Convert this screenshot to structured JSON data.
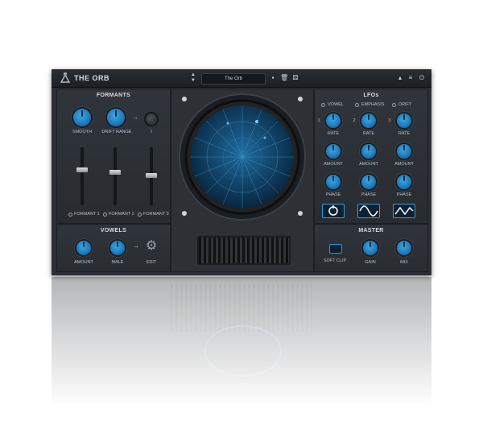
{
  "header": {
    "title": "THE ORB",
    "preset_name": "The Orb"
  },
  "formants": {
    "title": "FORMANTS",
    "smooth_label": "SMOOTH",
    "drift_range_label": "DRIFT RANGE",
    "drift_side_label": "I",
    "channels": [
      {
        "label": "FORMANT 1"
      },
      {
        "label": "FORMANT 2"
      },
      {
        "label": "FORMANT 3"
      }
    ]
  },
  "vowels": {
    "title": "VOWELS",
    "amount_label": "AMOUNT",
    "male_label": "MALE",
    "edit_label": "EDIT"
  },
  "lfos": {
    "title": "LFOs",
    "targets": [
      "VOWEL",
      "EMPHASIS",
      "DRIFT"
    ],
    "rate_labels": [
      "RATE",
      "RATE",
      "RATE"
    ],
    "amount_labels": [
      "AMOUNT",
      "AMOUNT",
      "AMOUNT"
    ],
    "phase_labels": [
      "PHASE",
      "PHASE",
      "PHASE"
    ],
    "number_labels": [
      "1",
      "2",
      "3"
    ],
    "shapes": [
      "cycle",
      "sine",
      "triangle"
    ]
  },
  "master": {
    "title": "MASTER",
    "soft_clip_label": "SOFT CLIP",
    "gain_label": "GAIN",
    "mix_label": "MIX"
  },
  "colors": {
    "accent": "#2f93d6",
    "panel": "#2b2f35",
    "text": "#b8c0c8"
  }
}
